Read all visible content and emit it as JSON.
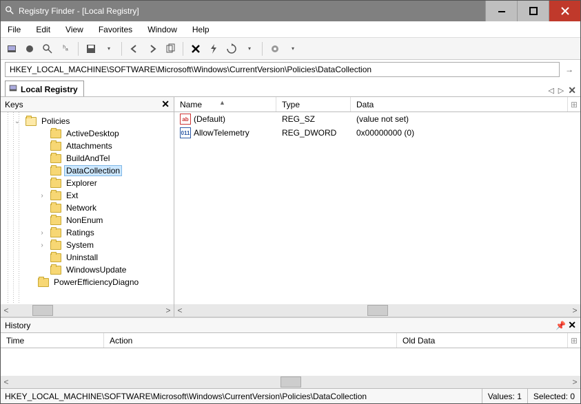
{
  "window": {
    "title": "Registry Finder - [Local Registry]"
  },
  "menu": {
    "file": "File",
    "edit": "Edit",
    "view": "View",
    "favorites": "Favorites",
    "window": "Window",
    "help": "Help"
  },
  "address": {
    "path": "HKEY_LOCAL_MACHINE\\SOFTWARE\\Microsoft\\Windows\\CurrentVersion\\Policies\\DataCollection"
  },
  "tab": {
    "label": "Local Registry"
  },
  "keys": {
    "header": "Keys",
    "root": "Policies",
    "children": [
      {
        "label": "ActiveDesktop",
        "expander": ""
      },
      {
        "label": "Attachments",
        "expander": ""
      },
      {
        "label": "BuildAndTel",
        "expander": ""
      },
      {
        "label": "DataCollection",
        "expander": "",
        "selected": true
      },
      {
        "label": "Explorer",
        "expander": ""
      },
      {
        "label": "Ext",
        "expander": ">"
      },
      {
        "label": "Network",
        "expander": ""
      },
      {
        "label": "NonEnum",
        "expander": ""
      },
      {
        "label": "Ratings",
        "expander": ">"
      },
      {
        "label": "System",
        "expander": ">"
      },
      {
        "label": "Uninstall",
        "expander": ""
      },
      {
        "label": "WindowsUpdate",
        "expander": ""
      }
    ],
    "cut": "PowerEfficiencyDiagno"
  },
  "values": {
    "columns": {
      "name": "Name",
      "type": "Type",
      "data": "Data"
    },
    "rows": [
      {
        "icon": "sz",
        "name": "(Default)",
        "type": "REG_SZ",
        "data": "(value not set)"
      },
      {
        "icon": "dw",
        "name": "AllowTelemetry",
        "type": "REG_DWORD",
        "data": "0x00000000 (0)"
      }
    ]
  },
  "history": {
    "header": "History",
    "columns": {
      "time": "Time",
      "action": "Action",
      "old": "Old Data"
    }
  },
  "status": {
    "path": "HKEY_LOCAL_MACHINE\\SOFTWARE\\Microsoft\\Windows\\CurrentVersion\\Policies\\DataCollection",
    "values_label": "Values:",
    "values_count": "1",
    "selected_label": "Selected:",
    "selected_count": "0"
  },
  "icon_labels": {
    "sz": "ab",
    "dw": "011"
  }
}
